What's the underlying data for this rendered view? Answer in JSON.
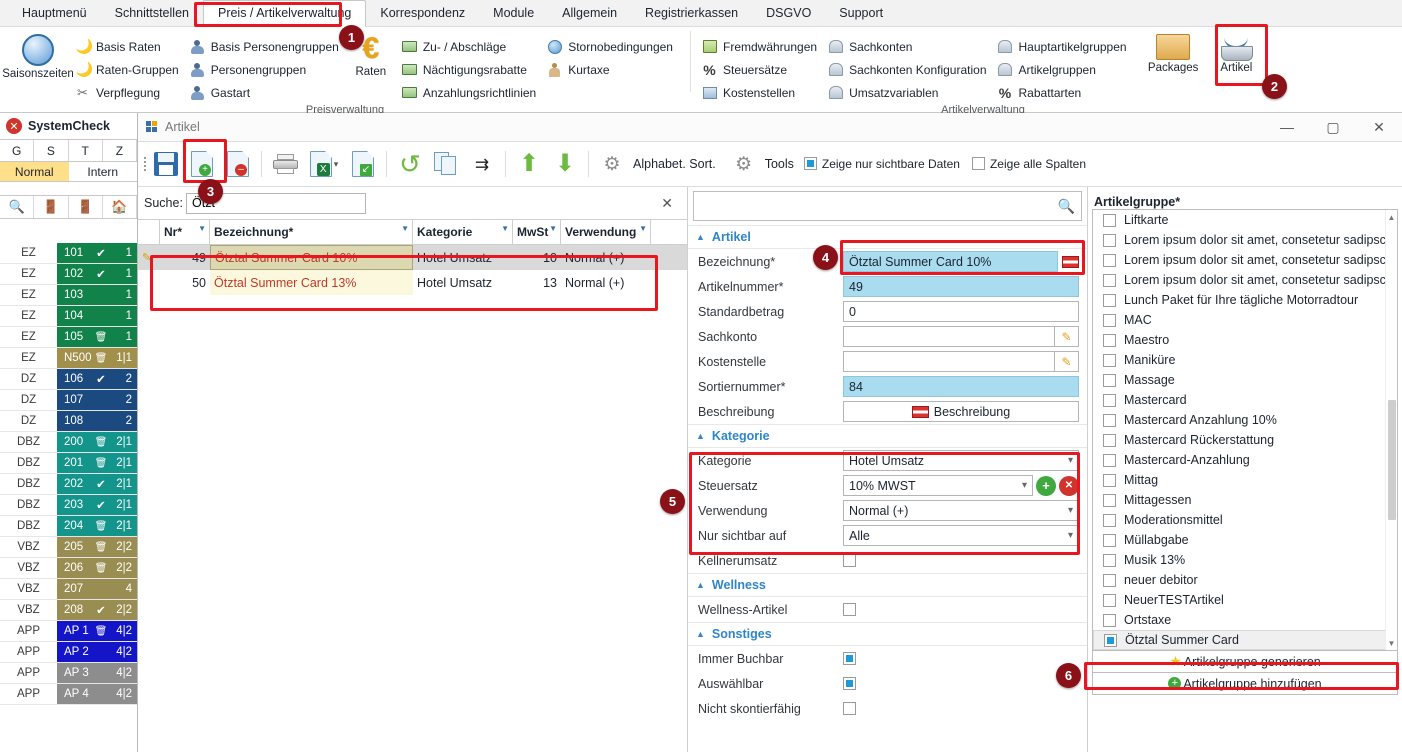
{
  "ribbon": {
    "tabs": [
      {
        "label": "Hauptmenü",
        "active": false
      },
      {
        "label": "Schnittstellen",
        "active": false
      },
      {
        "label": "Preis / Artikelverwaltung",
        "active": true
      },
      {
        "label": "Korrespondenz",
        "active": false
      },
      {
        "label": "Module",
        "active": false
      },
      {
        "label": "Allgemein",
        "active": false
      },
      {
        "label": "Registrierkassen",
        "active": false
      },
      {
        "label": "DSGVO",
        "active": false
      },
      {
        "label": "Support",
        "active": false
      }
    ],
    "groups": [
      {
        "title": "Preisverwaltung",
        "big": [
          {
            "label": "Saisonszeiten",
            "icon": "clock-icon"
          }
        ],
        "cols": [
          {
            "items": [
              {
                "label": "Basis Raten",
                "icon": "moon-icon"
              },
              {
                "label": "Raten-Gruppen",
                "icon": "moon-icon"
              },
              {
                "label": "Verpflegung",
                "icon": "cutlery-icon"
              }
            ]
          },
          {
            "items": [
              {
                "label": "Basis Personengruppen",
                "icon": "people-icon"
              },
              {
                "label": "Personengruppen",
                "icon": "people-icon"
              },
              {
                "label": "Gastart",
                "icon": "people-icon"
              }
            ]
          }
        ],
        "big2": [
          {
            "label": "Raten",
            "icon": "euro-icon"
          }
        ],
        "cols2": [
          {
            "items": [
              {
                "label": "Zu- / Abschläge",
                "icon": "money-icon"
              },
              {
                "label": "Nächtigungsrabatte",
                "icon": "money-icon"
              },
              {
                "label": "Anzahlungsrichtlinien",
                "icon": "money-icon"
              }
            ]
          },
          {
            "items": [
              {
                "label": "Stornobedingungen",
                "icon": "clock-blue-icon"
              },
              {
                "label": "Kurtaxe",
                "icon": "kurtaxe-icon"
              }
            ]
          }
        ]
      },
      {
        "title": "Artikelverwaltung",
        "cols": [
          {
            "items": [
              {
                "label": "Fremdwährungen",
                "icon": "currency-icon"
              },
              {
                "label": "Steuersätze",
                "icon": "percent-icon"
              },
              {
                "label": "Kostenstellen",
                "icon": "costcenter-icon"
              }
            ]
          },
          {
            "items": [
              {
                "label": "Sachkonten",
                "icon": "bank-icon"
              },
              {
                "label": "Sachkonten Konfiguration",
                "icon": "bank-icon"
              },
              {
                "label": "Umsatzvariablen",
                "icon": "bank-icon"
              }
            ]
          },
          {
            "items": [
              {
                "label": "Hauptartikelgruppen",
                "icon": "bank-icon"
              },
              {
                "label": "Artikelgruppen",
                "icon": "bank-icon"
              },
              {
                "label": "Rabattarten",
                "icon": "percent-icon"
              }
            ]
          }
        ],
        "big": [
          {
            "label": "Packages",
            "icon": "folder-icon"
          },
          {
            "label": "Artikel",
            "icon": "basket-icon"
          }
        ]
      }
    ]
  },
  "sidebar": {
    "title": "SystemCheck",
    "close_icon": "✕",
    "tabs_gstz": [
      "G",
      "S",
      "T",
      "Z"
    ],
    "mode_tabs": [
      {
        "label": "Normal",
        "active": true
      },
      {
        "label": "Intern",
        "active": false
      }
    ],
    "nav_icons": [
      "search-icon",
      "exit-right-icon",
      "exit-left-icon",
      "home-icon"
    ],
    "rooms": [
      {
        "cat": "EZ",
        "nr": "101",
        "mark": "check",
        "count": "1",
        "color": "#11824a"
      },
      {
        "cat": "EZ",
        "nr": "102",
        "mark": "check",
        "count": "1",
        "color": "#11824a"
      },
      {
        "cat": "EZ",
        "nr": "103",
        "mark": "",
        "count": "1",
        "color": "#11824a"
      },
      {
        "cat": "EZ",
        "nr": "104",
        "mark": "",
        "count": "1",
        "color": "#11824a"
      },
      {
        "cat": "EZ",
        "nr": "105",
        "mark": "trash",
        "count": "1",
        "color": "#11824a"
      },
      {
        "cat": "EZ",
        "nr": "N500",
        "mark": "trash",
        "count": "1|1",
        "color": "#a18f4a"
      },
      {
        "cat": "DZ",
        "nr": "106",
        "mark": "check",
        "count": "2",
        "color": "#1b4a80"
      },
      {
        "cat": "DZ",
        "nr": "107",
        "mark": "",
        "count": "2",
        "color": "#1b4a80"
      },
      {
        "cat": "DZ",
        "nr": "108",
        "mark": "",
        "count": "2",
        "color": "#1b4a80"
      },
      {
        "cat": "DBZ",
        "nr": "200",
        "mark": "trash",
        "count": "2|1",
        "color": "#13958c"
      },
      {
        "cat": "DBZ",
        "nr": "201",
        "mark": "trash",
        "count": "2|1",
        "color": "#13958c"
      },
      {
        "cat": "DBZ",
        "nr": "202",
        "mark": "check",
        "count": "2|1",
        "color": "#13958c"
      },
      {
        "cat": "DBZ",
        "nr": "203",
        "mark": "check",
        "count": "2|1",
        "color": "#13958c"
      },
      {
        "cat": "DBZ",
        "nr": "204",
        "mark": "trash",
        "count": "2|1",
        "color": "#13958c"
      },
      {
        "cat": "VBZ",
        "nr": "205",
        "mark": "trash",
        "count": "2|2",
        "color": "#9a8d51"
      },
      {
        "cat": "VBZ",
        "nr": "206",
        "mark": "trash",
        "count": "2|2",
        "color": "#9a8d51"
      },
      {
        "cat": "VBZ",
        "nr": "207",
        "mark": "",
        "count": "4",
        "color": "#9a8d51"
      },
      {
        "cat": "VBZ",
        "nr": "208",
        "mark": "check",
        "count": "2|2",
        "color": "#9a8d51"
      },
      {
        "cat": "APP",
        "nr": "AP 1",
        "mark": "trash",
        "count": "4|2",
        "color": "#1414c8"
      },
      {
        "cat": "APP",
        "nr": "AP 2",
        "mark": "",
        "count": "4|2",
        "color": "#1414c8"
      },
      {
        "cat": "APP",
        "nr": "AP 3",
        "mark": "",
        "count": "4|2",
        "color": "#8d8d8d"
      },
      {
        "cat": "APP",
        "nr": "AP 4",
        "mark": "",
        "count": "4|2",
        "color": "#8d8d8d"
      }
    ]
  },
  "window": {
    "title": "Artikel",
    "minimize": "—",
    "maximize": "▢",
    "close": "✕",
    "toolbar": {
      "buttons": [
        {
          "name": "save-button",
          "icon": "save-icon"
        },
        {
          "name": "new-button",
          "icon": "new-document-icon"
        },
        {
          "name": "delete-button",
          "icon": "delete-document-icon"
        },
        {
          "name": "print-button",
          "icon": "printer-icon"
        },
        {
          "name": "export-excel-button",
          "icon": "excel-export-icon"
        },
        {
          "name": "report-button",
          "icon": "report-icon"
        },
        {
          "name": "undo-button",
          "icon": "undo-icon"
        },
        {
          "name": "copy-button",
          "icon": "copy-icon"
        },
        {
          "name": "merge-button",
          "icon": "merge-arrow-icon"
        },
        {
          "name": "move-up-button",
          "icon": "arrow-up-icon"
        },
        {
          "name": "move-down-button",
          "icon": "arrow-down-icon"
        }
      ],
      "alphabet_sort_label": "Alphabet. Sort.",
      "tools_label": "Tools",
      "checkbox_visible_data": {
        "label": "Zeige nur sichtbare Daten",
        "checked": true
      },
      "checkbox_all_columns": {
        "label": "Zeige alle Spalten",
        "checked": false
      }
    }
  },
  "grid": {
    "search_label": "Suche:",
    "search_value": "Ötzt",
    "search_placeholder": "",
    "clear_icon": "✕",
    "columns": [
      "Nr*",
      "Bezeichnung*",
      "Kategorie",
      "MwSt",
      "Verwendung"
    ],
    "rows": [
      {
        "nr": "49",
        "bezeichnung": "Ötztal Summer Card 10%",
        "kategorie": "Hotel Umsatz",
        "mwst": "10",
        "verwendung": "Normal (+)",
        "selected": true
      },
      {
        "nr": "50",
        "bezeichnung": "Ötztal Summer Card 13%",
        "kategorie": "Hotel Umsatz",
        "mwst": "13",
        "verwendung": "Normal (+)",
        "selected": false
      }
    ]
  },
  "detail": {
    "search_icon": "search-icon",
    "sections": [
      {
        "title": "Artikel",
        "fields": [
          {
            "label": "Bezeichnung*",
            "value": "Ötztal Summer Card 10%",
            "type": "text-flag",
            "style": "blue"
          },
          {
            "label": "Artikelnummer*",
            "value": "49",
            "type": "text",
            "style": "blue"
          },
          {
            "label": "Standardbetrag",
            "value": "0",
            "type": "text",
            "style": "plain"
          },
          {
            "label": "Sachkonto",
            "value": "",
            "type": "text-pencil",
            "style": "plain"
          },
          {
            "label": "Kostenstelle",
            "value": "",
            "type": "text-pencil",
            "style": "plain"
          },
          {
            "label": "Sortiernummer*",
            "value": "84",
            "type": "text",
            "style": "blue"
          },
          {
            "label": "Beschreibung",
            "value": "Beschreibung",
            "type": "button-flag",
            "style": "plain"
          }
        ]
      },
      {
        "title": "Kategorie",
        "fields": [
          {
            "label": "Kategorie",
            "value": "Hotel Umsatz",
            "type": "dropdown"
          },
          {
            "label": "Steuersatz",
            "value": "10% MWST",
            "type": "dropdown-addremove",
            "add_label": "+",
            "remove_label": "✕"
          },
          {
            "label": "Verwendung",
            "value": "Normal (+)",
            "type": "dropdown"
          },
          {
            "label": "Nur sichtbar auf",
            "value": "Alle",
            "type": "dropdown"
          },
          {
            "label": "Kellnerumsatz",
            "value": "",
            "type": "checkbox",
            "checked": false
          }
        ]
      },
      {
        "title": "Wellness",
        "fields": [
          {
            "label": "Wellness-Artikel",
            "value": "",
            "type": "checkbox",
            "checked": false
          }
        ]
      },
      {
        "title": "Sonstiges",
        "fields": [
          {
            "label": "Immer Buchbar",
            "value": "",
            "type": "checkbox",
            "checked": true
          },
          {
            "label": "Auswählbar",
            "value": "",
            "type": "checkbox",
            "checked": true
          },
          {
            "label": "Nicht skontierfähig",
            "value": "",
            "type": "checkbox",
            "checked": false
          }
        ]
      }
    ]
  },
  "artikelgruppe": {
    "title": "Artikelgruppe*",
    "items": [
      {
        "label": "Liftkarte",
        "checked": false
      },
      {
        "label": "Lorem ipsum dolor sit amet, consetetur sadipscir",
        "checked": false
      },
      {
        "label": "Lorem ipsum dolor sit amet, consetetur sadipscir",
        "checked": false
      },
      {
        "label": "Lorem ipsum dolor sit amet, consetetur sadipscir",
        "checked": false
      },
      {
        "label": "Lunch Paket für Ihre tägliche Motorradtour",
        "checked": false
      },
      {
        "label": "MAC",
        "checked": false
      },
      {
        "label": "Maestro",
        "checked": false
      },
      {
        "label": "Maniküre",
        "checked": false
      },
      {
        "label": "Massage",
        "checked": false
      },
      {
        "label": "Mastercard",
        "checked": false
      },
      {
        "label": "Mastercard Anzahlung 10%",
        "checked": false
      },
      {
        "label": "Mastercard Rückerstattung",
        "checked": false
      },
      {
        "label": "Mastercard-Anzahlung",
        "checked": false
      },
      {
        "label": "Mittag",
        "checked": false
      },
      {
        "label": "Mittagessen",
        "checked": false
      },
      {
        "label": "Moderationsmittel",
        "checked": false
      },
      {
        "label": "Müllabgabe",
        "checked": false
      },
      {
        "label": "Musik 13%",
        "checked": false
      },
      {
        "label": "neuer debitor",
        "checked": false
      },
      {
        "label": "NeuerTESTArtikel",
        "checked": false
      },
      {
        "label": "Ortstaxe",
        "checked": false
      },
      {
        "label": "Ötztal Summer Card",
        "checked": true,
        "selected": true
      }
    ],
    "generate_button": "Artikelgruppe generieren",
    "add_button": "Artikelgruppe hinzufügen",
    "scroll_up_icon": "▲",
    "scroll_down_icon": "▼"
  },
  "callouts": [
    {
      "n": "1"
    },
    {
      "n": "2"
    },
    {
      "n": "3"
    },
    {
      "n": "4"
    },
    {
      "n": "5"
    },
    {
      "n": "6"
    }
  ],
  "colors": {
    "accent": "#e8161f",
    "callout_dot": "#8b1118",
    "section_title": "#2e86c8",
    "field_highlight": "#aadcf0",
    "selected_row": "#dcd9b0"
  }
}
